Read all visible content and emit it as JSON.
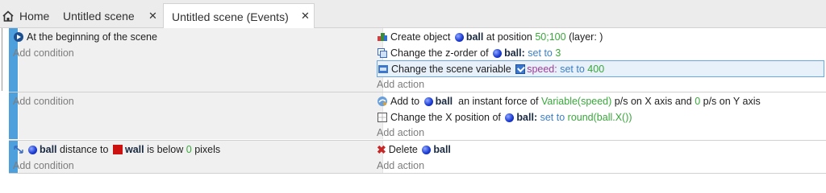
{
  "tabs": [
    {
      "label": "Home"
    },
    {
      "label": "Untitled scene",
      "close": "✕"
    },
    {
      "label": "Untitled scene (Events)",
      "close": "✕"
    }
  ],
  "events": [
    {
      "condition": "At the beginning of the scene",
      "add_condition": "Add condition",
      "actions": [
        {
          "pre": "Create object",
          "obj": "ball",
          "mid": "at position",
          "val": "50;100",
          "post": "(layer: )"
        },
        {
          "pre": "Change the z-order of",
          "obj": "ball",
          "op": "set to",
          "val": "3"
        },
        {
          "pre": "Change the scene variable",
          "var": "speed",
          "op": "set to",
          "val": "400"
        }
      ],
      "add_action": "Add action"
    },
    {
      "add_condition": "Add condition",
      "actions": [
        {
          "pre": "Add to",
          "obj": "ball",
          "mid": "an instant force of",
          "val": "Variable(speed)",
          "mid2": "p/s on X axis and",
          "val2": "0",
          "post": "p/s on Y axis"
        },
        {
          "pre": "Change the X position of",
          "obj": "ball",
          "op": "set to",
          "val": "round(ball.X())"
        }
      ],
      "add_action": "Add action"
    },
    {
      "condition": {
        "obj": "ball",
        "mid": "distance to",
        "obj2": "wall",
        "mid2": "is below",
        "val": "0",
        "post": "pixels"
      },
      "add_condition": "Add condition",
      "actions": [
        {
          "pre": "Delete",
          "obj": "ball"
        }
      ],
      "add_action": "Add action"
    }
  ],
  "colors": {
    "event_bar": "#4ea0dc",
    "value_green": "#38a83a",
    "op_blue": "#3c7fc7",
    "variable_purple": "#9b3f98"
  }
}
